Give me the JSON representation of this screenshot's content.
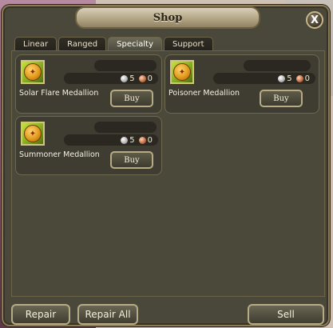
{
  "window": {
    "title": "Shop",
    "close_label": "X"
  },
  "tabs": [
    {
      "label": "Linear",
      "active": false
    },
    {
      "label": "Ranged",
      "active": false
    },
    {
      "label": "Specialty",
      "active": true
    },
    {
      "label": "Support",
      "active": false
    }
  ],
  "items": [
    {
      "name": "Solar Flare Medallion",
      "silver": "5",
      "copper": "0",
      "buy_label": "Buy"
    },
    {
      "name": "Poisoner Medallion",
      "silver": "5",
      "copper": "0",
      "buy_label": "Buy"
    },
    {
      "name": "Summoner Medallion",
      "silver": "5",
      "copper": "0",
      "buy_label": "Buy"
    }
  ],
  "footer": {
    "repair_label": "Repair",
    "repair_all_label": "Repair All",
    "sell_label": "Sell"
  },
  "colors": {
    "panel": "#4b493a",
    "card": "#3f3d31",
    "border": "#b7ab86",
    "icon_bg": "#7da61f"
  }
}
